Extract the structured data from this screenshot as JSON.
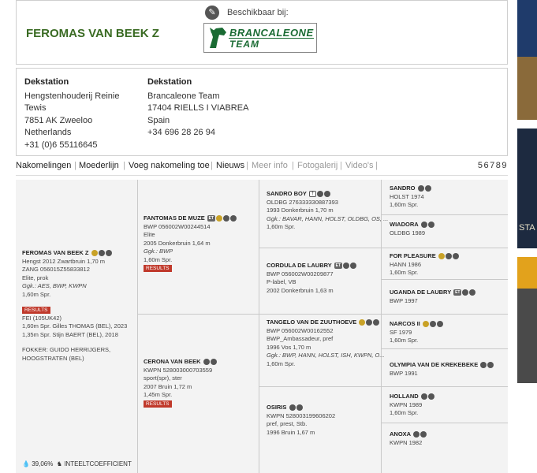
{
  "horse": {
    "name": "FEROMAS VAN BEEK Z"
  },
  "availability": {
    "label": "Beschikbaar bij:",
    "logo_line1": "BRANCALEONE",
    "logo_line2": "TEAM"
  },
  "contact": [
    {
      "heading": "Dekstation",
      "lines": [
        "Hengstenhouderij Reinie",
        "Tewis",
        "7851 AK Zweeloo",
        "Netherlands",
        "+31 (0)6 55116645"
      ]
    },
    {
      "heading": "Dekstation",
      "lines": [
        "Brancaleone Team",
        "17404 RIELLS I VIABREA",
        "Spain",
        "+34 696 28 26 94"
      ]
    }
  ],
  "tabs": [
    "Nakomelingen",
    "Moederlijn",
    "Voeg nakomeling toe",
    "Nieuws",
    "Meer info",
    "Fotogalerij",
    "Video's"
  ],
  "pages": "56789",
  "pedigree": {
    "subject": {
      "name": "FEROMAS VAN BEEK Z",
      "l1": "Hengst 2012 Zwartbruin 1,70 m",
      "l2": "ZANG 056015Z55833812",
      "l3": "Elite, prok",
      "l4": "Ggk.: AES, BWP, KWPN",
      "l5": "1,60m Spr.",
      "results": "RESULTS",
      "r1": "FEI (105UK42)",
      "r2": "1,60m Spr. Gilles THOMAS (BEL), 2023",
      "r3": "1,35m Spr. Stijn BAERT (BEL), 2018",
      "f1": "FOKKER: GUIDO HERRIJGERS,",
      "f2": "HOOGSTRATEN (BEL)"
    },
    "sire": {
      "name": "FANTOMAS DE MUZE",
      "l1": "BWP 056002W00244514",
      "l2": "Elite",
      "l3": "2005 Donkerbruin 1,64 m",
      "l4": "Ggk.: BWP",
      "l5": "1,60m Spr.",
      "results": "RESULTS"
    },
    "dam": {
      "name": "CERONA VAN BEEK",
      "l1": "KWPN 528003000703559",
      "l2": "sport(spr), ster",
      "l3": "2007 Bruin 1,72 m",
      "l4": "1,45m Spr.",
      "results": "RESULTS"
    },
    "ss": {
      "name": "SANDRO BOY",
      "l1": "OLDBG 276333330887393",
      "l2": "1993 Donkerbruin 1,70 m",
      "l3": "Ggk.: BAVAR, HANN, HOLST, OLDBG, OS, ...",
      "l4": "1,60m Spr."
    },
    "sd": {
      "name": "CORDULA DE LAUBRY",
      "l1": "BWP 056002W00209877",
      "l2": "P-label, VB",
      "l3": "2002 Donkerbruin 1,63 m"
    },
    "ds": {
      "name": "TANGELO VAN DE ZUUTHOEVE",
      "l1": "BWP 056002W00162552",
      "l2": "BWP_Ambassadeur, pref",
      "l3": "1996 Vos 1,70 m",
      "l4": "Ggk.: BWP, HANN, HOLST, ISH, KWPN, O...",
      "l5": "1,60m Spr."
    },
    "dd": {
      "name": "OSIRIS",
      "l1": "KWPN 528003199606202",
      "l2": "pref, prest, Stb.",
      "l3": "1996 Bruin 1,67 m"
    },
    "g4": [
      {
        "name": "SANDRO",
        "l1": "HOLST 1974",
        "l2": "1,60m Spr."
      },
      {
        "name": "WIADORA",
        "l1": "OLDBG 1989",
        "l2": ""
      },
      {
        "name": "FOR PLEASURE",
        "l1": "HANN 1986",
        "l2": "1,60m Spr."
      },
      {
        "name": "UGANDA DE LAUBRY",
        "l1": "BWP 1997",
        "l2": ""
      },
      {
        "name": "NARCOS II",
        "l1": "SF 1979",
        "l2": "1,60m Spr."
      },
      {
        "name": "OLYMPIA VAN DE KREKEBEKE",
        "l1": "BWP 1991",
        "l2": ""
      },
      {
        "name": "HOLLAND",
        "l1": "KWPN 1989",
        "l2": "1,60m Spr."
      },
      {
        "name": "ANOXA",
        "l1": "KWPN 1982",
        "l2": ""
      }
    ],
    "inbreeding_value": "39,06%",
    "inbreeding_label": "INTEELTCOEFFICIENT"
  },
  "colors": {
    "title_green": "#3a6b23",
    "results_red": "#c0392b",
    "logo_green": "#1a6b33"
  }
}
